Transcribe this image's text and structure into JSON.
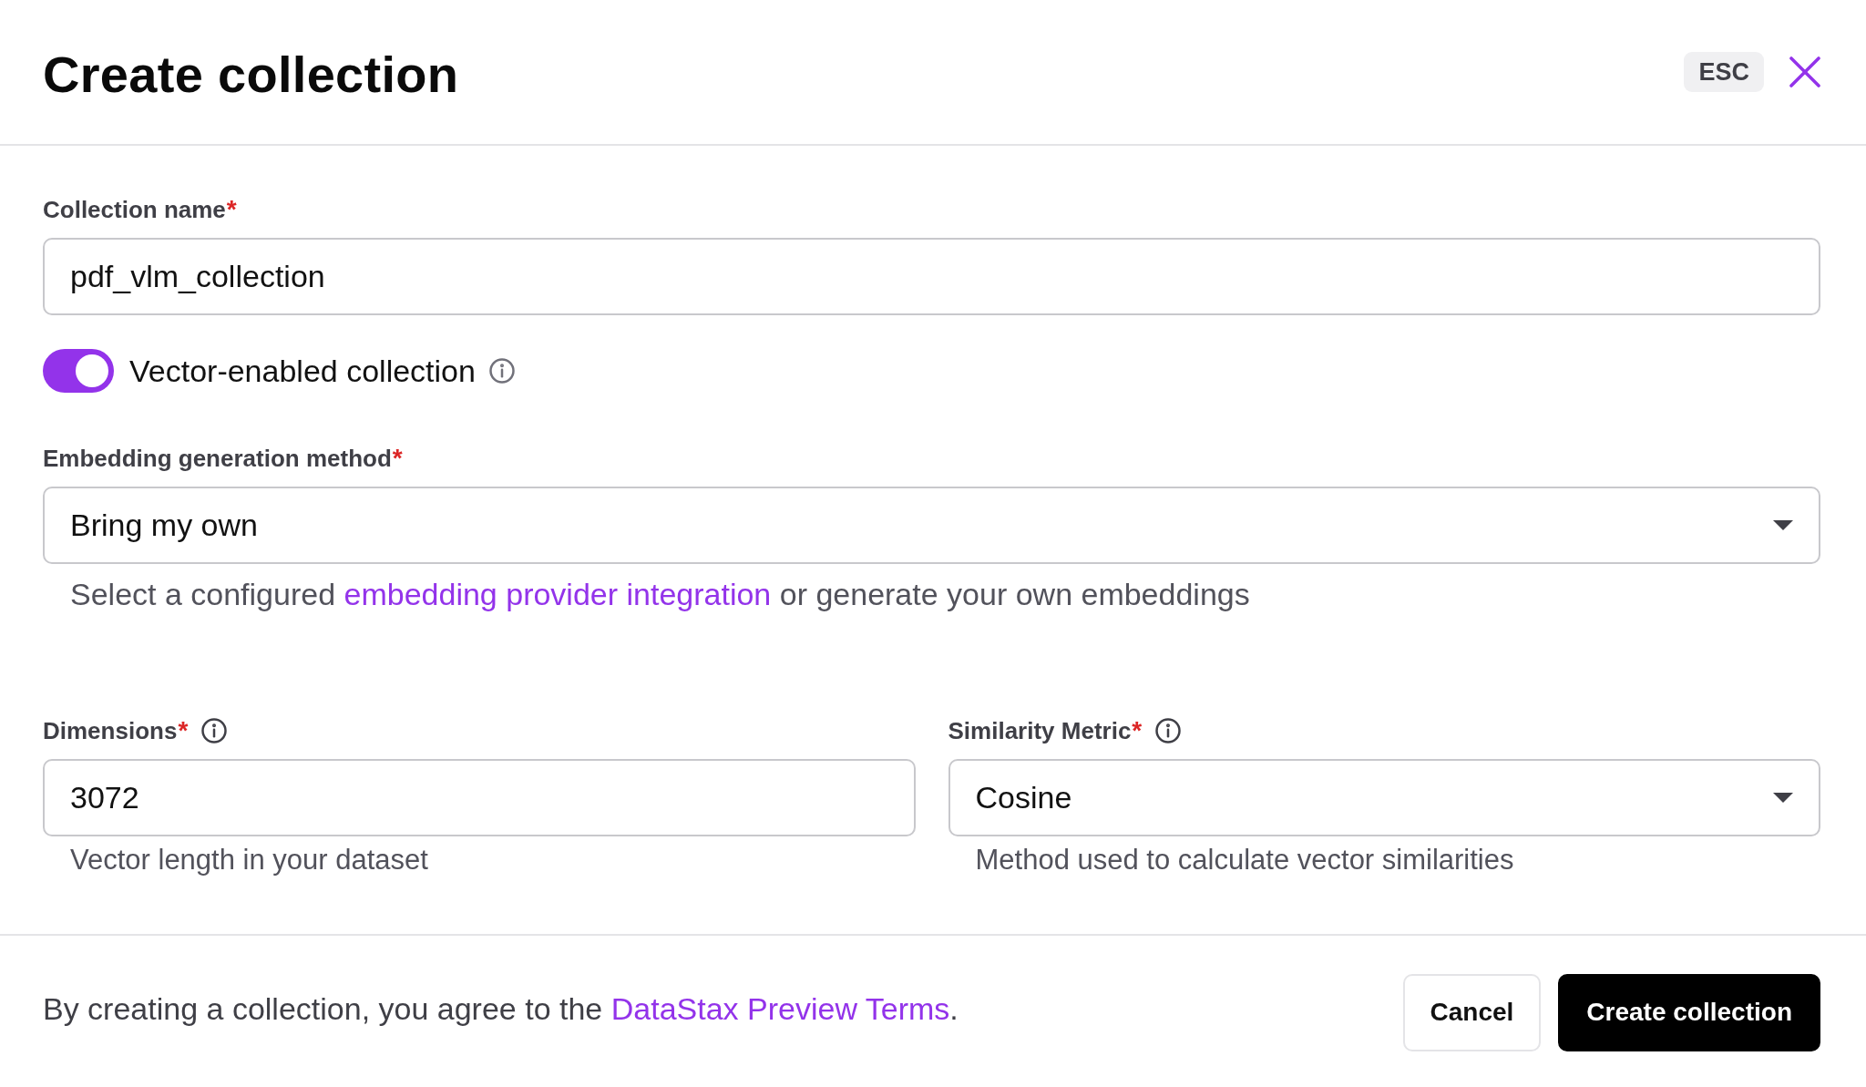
{
  "header": {
    "title": "Create collection",
    "shortcut": "ESC"
  },
  "form": {
    "collection_name": {
      "label": "Collection name",
      "required_mark": "*",
      "value": "pdf_vlm_collection"
    },
    "vector_enabled": {
      "label": "Vector-enabled collection",
      "on": true
    },
    "embedding_method": {
      "label": "Embedding generation method",
      "required_mark": "*",
      "value": "Bring my own",
      "help": {
        "before": "Select a configured ",
        "link": "embedding provider integration",
        "after": " or generate your own embeddings"
      }
    },
    "dimensions": {
      "label": "Dimensions",
      "required_mark": "*",
      "value": "3072",
      "help": "Vector length in your dataset"
    },
    "similarity_metric": {
      "label": "Similarity Metric",
      "required_mark": "*",
      "value": "Cosine",
      "help": "Method used to calculate vector similarities"
    }
  },
  "footer": {
    "notice": {
      "before": "By creating a collection, you agree to the ",
      "link": "DataStax Preview Terms",
      "after": "."
    },
    "buttons": [
      {
        "label": "Cancel",
        "kind": "secondary"
      },
      {
        "label": "Create collection",
        "kind": "primary"
      }
    ]
  }
}
